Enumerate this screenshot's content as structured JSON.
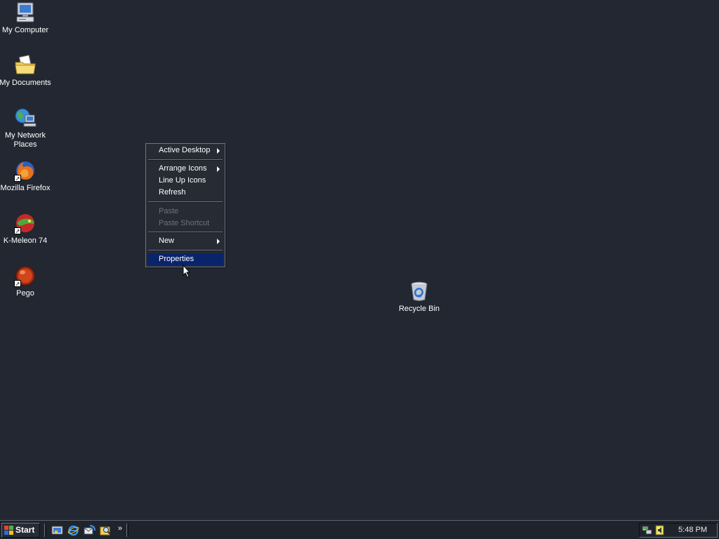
{
  "desktop": {
    "background_color": "#222731",
    "icons": [
      {
        "label": "My Computer",
        "icon": "my-computer-icon"
      },
      {
        "label": "My Documents",
        "icon": "my-documents-icon"
      },
      {
        "label": "My Network Places",
        "icon": "network-places-icon"
      },
      {
        "label": "Mozilla Firefox",
        "icon": "firefox-icon"
      },
      {
        "label": "K-Meleon 74",
        "icon": "k-meleon-icon"
      },
      {
        "label": "Pego",
        "icon": "pego-icon"
      },
      {
        "label": "Recycle Bin",
        "icon": "recycle-bin-icon"
      }
    ]
  },
  "context_menu": {
    "items": [
      {
        "label": "Active Desktop",
        "submenu": true,
        "enabled": true
      },
      {
        "label": "Arrange Icons",
        "submenu": true,
        "enabled": true
      },
      {
        "label": "Line Up Icons",
        "submenu": false,
        "enabled": true
      },
      {
        "label": "Refresh",
        "submenu": false,
        "enabled": true
      },
      {
        "label": "Paste",
        "submenu": false,
        "enabled": false
      },
      {
        "label": "Paste Shortcut",
        "submenu": false,
        "enabled": false
      },
      {
        "label": "New",
        "submenu": true,
        "enabled": true
      },
      {
        "label": "Properties",
        "submenu": false,
        "enabled": true,
        "highlighted": true
      }
    ],
    "highlight_color": "#0a246a"
  },
  "taskbar": {
    "start_label": "Start",
    "quick_launch": [
      "show-desktop-icon",
      "internet-explorer-icon",
      "outlook-express-icon",
      "search-icon"
    ],
    "overflow_label": "»",
    "tray_icons": [
      "network-connection-icon",
      "volume-icon"
    ],
    "clock": "5:48 PM"
  }
}
